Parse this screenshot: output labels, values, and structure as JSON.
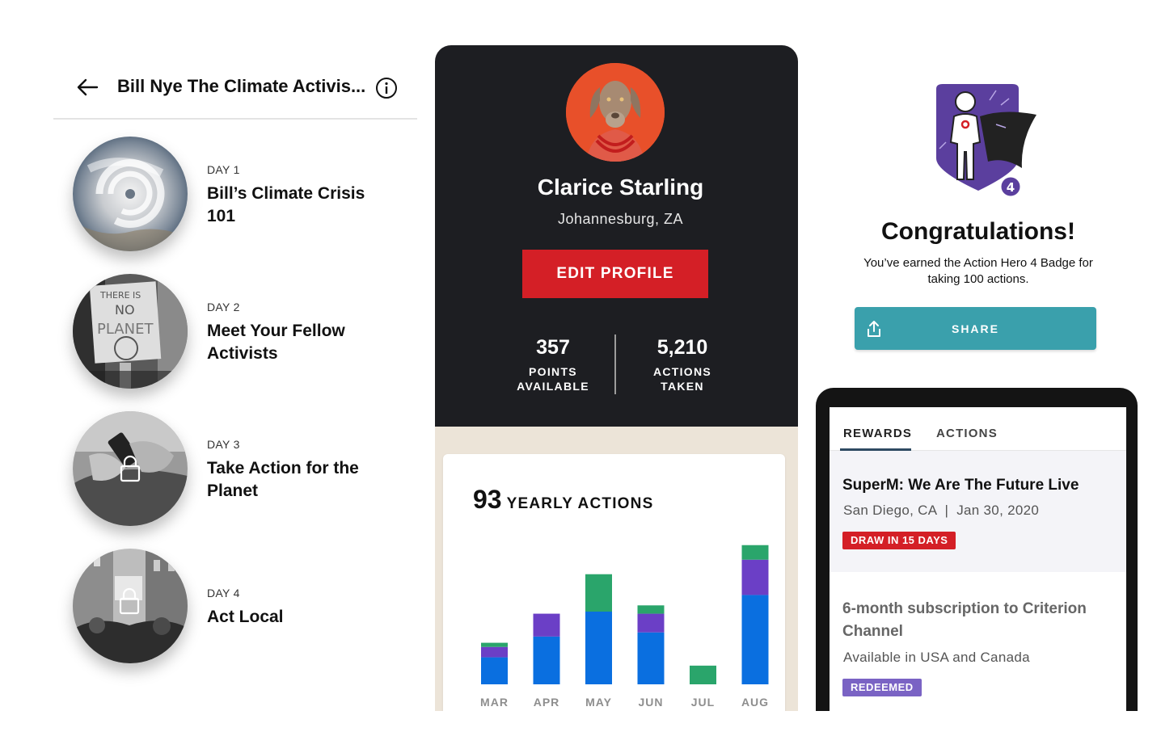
{
  "course": {
    "title": "Bill Nye The Climate Activis...",
    "days": [
      {
        "label": "DAY 1",
        "title": "Bill’s Climate Crisis 101",
        "image": "hurricane-satellite"
      },
      {
        "label": "DAY 2",
        "title": "Meet Your Fellow Activists",
        "image": "protest-sign-there-is-no-planet-b"
      },
      {
        "label": "DAY 3",
        "title": "Take Action for the Planet",
        "image": "hands-with-phone-locked"
      },
      {
        "label": "DAY 4",
        "title": "Act Local",
        "image": "street-protest-locked"
      }
    ]
  },
  "profile": {
    "name": "Clarice Starling",
    "location": "Johannesburg, ZA",
    "edit_label": "EDIT PROFILE",
    "points": {
      "value": "357",
      "label_line1": "POINTS",
      "label_line2": "AVAILABLE"
    },
    "actions": {
      "value": "5,210",
      "label_line1": "ACTIONS",
      "label_line2": "TAKEN"
    },
    "yearly_count": "93",
    "yearly_label": "YEARLY ACTIONS"
  },
  "chart_data": {
    "type": "bar",
    "stacked": true,
    "categories": [
      "MAR",
      "APR",
      "MAY",
      "JUN",
      "JUL",
      "AUG"
    ],
    "series": [
      {
        "color": "#0a6fe0",
        "values": [
          13,
          23,
          35,
          25,
          0,
          43
        ]
      },
      {
        "color": "#6b3fc6",
        "values": [
          5,
          11,
          0,
          9,
          0,
          17
        ]
      },
      {
        "color": "#2aa56b",
        "values": [
          2,
          0,
          18,
          4,
          9,
          7
        ]
      }
    ],
    "ylim": [
      0,
      70
    ],
    "grid": false,
    "legend": "none"
  },
  "congrats": {
    "badge_level": "4",
    "title": "Congratulations!",
    "message": "You’ve earned the Action Hero 4 Badge for taking 100 actions.",
    "share_label": "SHARE"
  },
  "rewards": {
    "tabs": [
      {
        "label": "REWARDS",
        "active": true
      },
      {
        "label": "ACTIONS",
        "active": false
      }
    ],
    "items": [
      {
        "title": "SuperM: We Are The Future Live",
        "subtitle": "San Diego, CA  |  Jan 30, 2020",
        "tag": "DRAW IN 15 DAYS",
        "tag_color": "#d41f26"
      },
      {
        "title": "6-month subscription to Criterion Channel",
        "subtitle": "Available in USA and Canada",
        "tag": "REDEEMED",
        "tag_color": "#7a63c4"
      }
    ]
  }
}
